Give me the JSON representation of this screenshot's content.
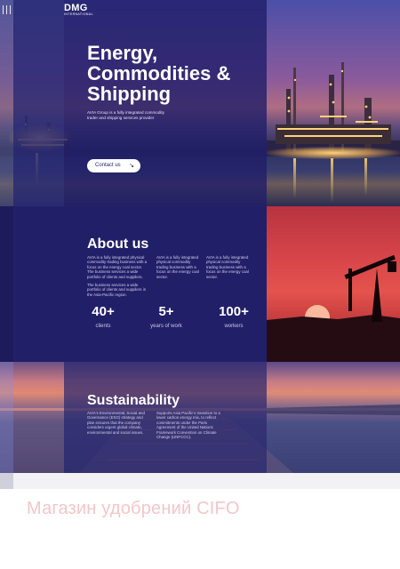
{
  "header": {
    "logo_main": "DMG",
    "logo_sub": "INTERNATIONAL",
    "menu_icon": "hamburger-icon"
  },
  "hero": {
    "title": "Energy,\nCommodities &\nShipping",
    "subtitle": "AVIA Group is a fully integrated commodity trader and shipping services provider",
    "cta_label": "Contact us",
    "cta_icon": "arrow-down-right-icon"
  },
  "about": {
    "title": "About us",
    "col1_p1": "AVIA is a fully integrated physical commodity trading business with a focus on the energy coal sector. The business services a wide portfolio of clients and suppliers.",
    "col1_p2": "The business services a wide portfolio of clients and suppliers in the Asia-Pacific region.",
    "col2": "AVIA is a fully integrated physical commodity trading business with a focus on the energy coal sector.",
    "col3": "AVIA is a fully integrated physical commodity trading business with a focus on the energy coal sector.",
    "stats": [
      {
        "value": "40+",
        "label": "clients"
      },
      {
        "value": "5+",
        "label": "years of work"
      },
      {
        "value": "100+",
        "label": "workers"
      }
    ]
  },
  "sustainability": {
    "title": "Sustainability",
    "col1": "AVIA's Environmental, Social and Governance (ESG) strategy and plan ensures that the company considers urgent global climate, environmental and social issues.",
    "col2": "Supports Asia Pacific's transition to a lower carbon energy mix, to reflect commitments under the Paris Agreement of the United Nations Framework Convention on Climate Change (UNFCCC)."
  },
  "banner": {
    "text": "Магазин удобрений CIFO"
  },
  "colors": {
    "primary": "#221f69",
    "overlay": "#201e69",
    "white": "#ffffff",
    "banner_text": "#f4c6c8"
  }
}
